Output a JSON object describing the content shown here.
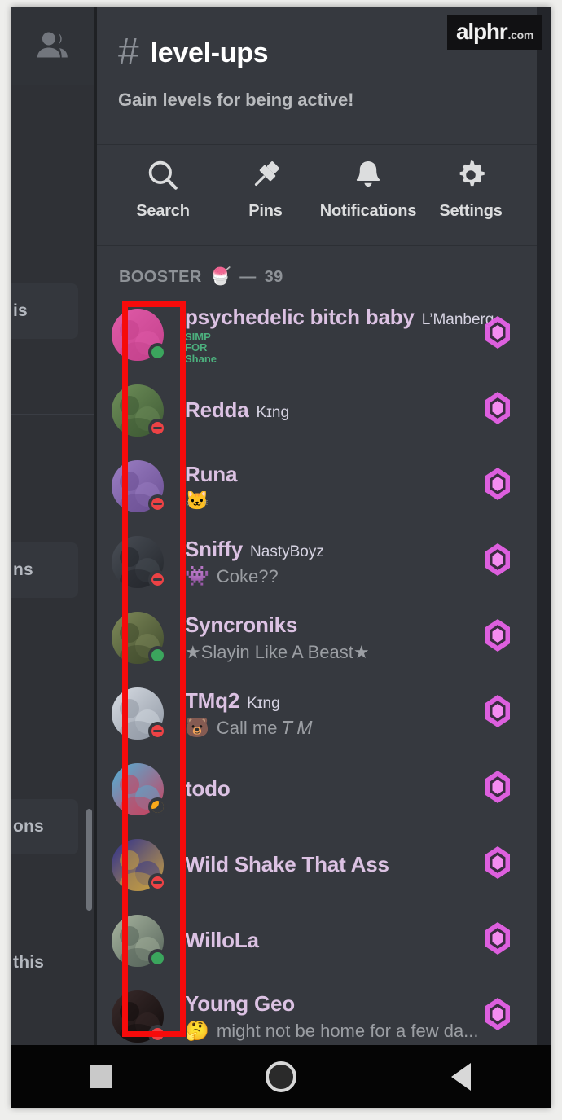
{
  "watermark": {
    "name": "alphr",
    "tld": ".com"
  },
  "left_panel": {
    "members_icon": "people-icon",
    "fragments": [
      {
        "text": "is"
      },
      {
        "text": "ns"
      },
      {
        "text": "ons"
      },
      {
        "text": "this"
      }
    ],
    "scrollbar": "channel-list-scrollbar"
  },
  "header": {
    "hash": "#",
    "channel_name": "level-ups",
    "topic": "Gain levels for being active!"
  },
  "actions": [
    {
      "label": "Search",
      "icon": "search-icon"
    },
    {
      "label": "Pins",
      "icon": "pin-icon"
    },
    {
      "label": "Notifications",
      "icon": "bell-icon"
    },
    {
      "label": "Settings",
      "icon": "gear-icon"
    }
  ],
  "section": {
    "label": "BOOSTER",
    "emoji": "🍧",
    "dash": "—",
    "count": "39"
  },
  "colors": {
    "accent_name": "#dcc2e3",
    "boost_gem": "#e761e7",
    "online": "#3ba55d",
    "dnd": "#ed4245",
    "idle": "#faa81a",
    "annotation": "#f60b0b",
    "background": "#36393f"
  },
  "members": [
    {
      "name": "psychedelic bitch baby",
      "tag": "L’Manberg",
      "status_emoji": "",
      "status_text": "",
      "tiny_status": [
        "SIMP",
        "FOR",
        "Shane"
      ],
      "presence": "online",
      "boost": "booster-gem-icon"
    },
    {
      "name": "Redda",
      "tag": "Kɪng",
      "status_emoji": "",
      "status_text": "",
      "presence": "dnd",
      "boost": "booster-gem-icon"
    },
    {
      "name": "Runa",
      "tag": "",
      "status_emoji": "🐱",
      "status_text": "",
      "presence": "dnd",
      "boost": "booster-gem-icon"
    },
    {
      "name": "Sniffy",
      "tag": "NastyBoyz",
      "status_emoji": "👾",
      "status_text": "Coke??",
      "presence": "dnd",
      "boost": "booster-gem-icon"
    },
    {
      "name": "Syncroniks",
      "tag": "",
      "status_emoji": "",
      "status_text": "★Slayin Like A Beast★",
      "presence": "online",
      "boost": "booster-gem-icon"
    },
    {
      "name": "TMq2",
      "tag": "Kɪng",
      "status_emoji": "🐻",
      "status_text": "Call me 𝑇 𝑀",
      "presence": "dnd",
      "boost": "booster-gem-icon"
    },
    {
      "name": "todo",
      "tag": "",
      "status_emoji": "",
      "status_text": "",
      "presence": "idle",
      "boost": "booster-gem-icon"
    },
    {
      "name": "Wild Shake That Ass",
      "tag": "",
      "status_emoji": "",
      "status_text": "",
      "presence": "dnd",
      "boost": "booster-gem-icon"
    },
    {
      "name": "WilloLa",
      "tag": "",
      "status_emoji": "",
      "status_text": "",
      "presence": "online",
      "boost": "booster-gem-icon"
    },
    {
      "name": "Young Geo",
      "tag": "",
      "status_emoji": "🤔",
      "status_text": "might not be home for a few da...",
      "presence": "dnd",
      "boost": "booster-gem-icon"
    }
  ],
  "navbar": [
    {
      "icon": "recents-square-icon"
    },
    {
      "icon": "home-circle-icon"
    },
    {
      "icon": "back-triangle-icon"
    }
  ]
}
